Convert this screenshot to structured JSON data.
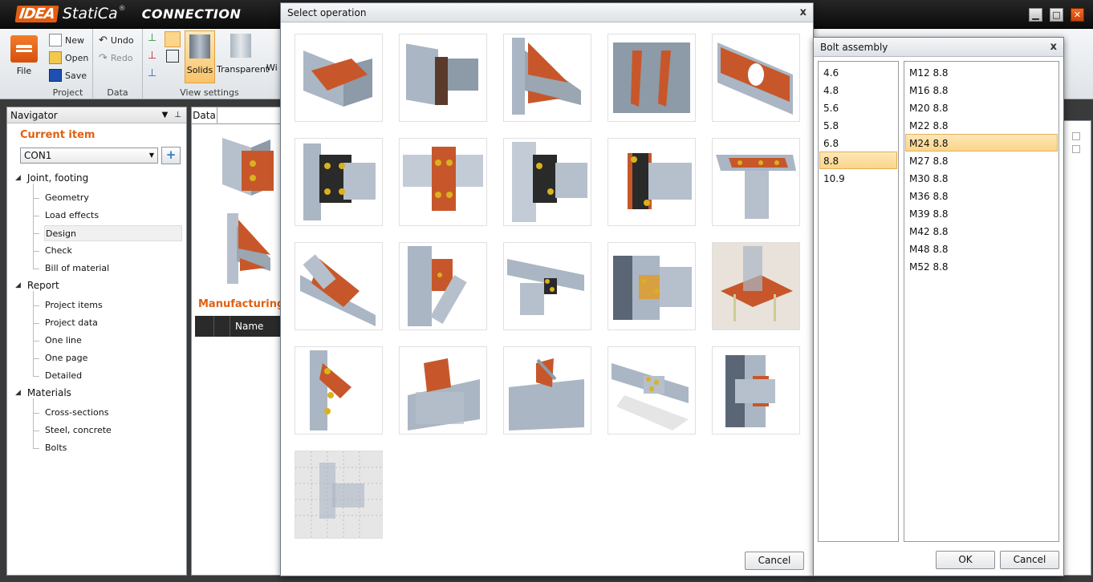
{
  "app": {
    "brand": "IDEA",
    "product": "StatiCa",
    "registered": "®",
    "module": "CONNECTION"
  },
  "window_controls": {
    "minimize": "▁",
    "maximize": "□",
    "close": "✕"
  },
  "ribbon": {
    "file_label": "File",
    "project": {
      "new": "New",
      "open": "Open",
      "save": "Save",
      "label": "Project"
    },
    "data": {
      "undo": "Undo",
      "redo": "Redo",
      "label": "Data"
    },
    "view": {
      "solids": "Solids",
      "transparent": "Transparent",
      "wire": "Wi",
      "label": "View settings"
    }
  },
  "navigator": {
    "title": "Navigator",
    "pin": "📌",
    "close": "✕",
    "current_item_title": "Current item",
    "current_item_value": "CON1",
    "add_button": "+",
    "sections": [
      {
        "label": "Joint, footing",
        "items": [
          "Geometry",
          "Load effects",
          "Design",
          "Check",
          "Bill of material"
        ]
      },
      {
        "label": "Report",
        "items": [
          "Project items",
          "Project data",
          "One line",
          "One page",
          "Detailed"
        ]
      },
      {
        "label": "Materials",
        "items": [
          "Cross-sections",
          "Steel, concrete",
          "Bolts"
        ]
      }
    ],
    "selected": "Design"
  },
  "data_panel": {
    "tab": "Data",
    "manufacturing_title": "Manufacturing o",
    "name_header": "Name"
  },
  "select_operation": {
    "title": "Select operation",
    "close": "x",
    "cancel": "Cancel",
    "tiles": [
      "end-plate-beam",
      "end-plate-splice",
      "stiffener-cut",
      "rib-stiffeners",
      "opening-plate",
      "bolted-end-plate",
      "bolted-joint",
      "bolted-column-joint",
      "end-plate-bolts",
      "cap-plate-bolts",
      "brace-gusset",
      "diagonal-gusset",
      "beam-cleat",
      "column-beam-fin",
      "base-plate-anchors",
      "bolted-haunch",
      "fin-plate",
      "gusset-plate",
      "bolted-splice",
      "welded-stiffener",
      "grid-model"
    ]
  },
  "bolt_assembly": {
    "title": "Bolt assembly",
    "close": "x",
    "grades": [
      "4.6",
      "4.8",
      "5.6",
      "5.8",
      "6.8",
      "8.8",
      "10.9"
    ],
    "selected_grade": "8.8",
    "bolts": [
      "M12 8.8",
      "M16 8.8",
      "M20 8.8",
      "M22 8.8",
      "M24 8.8",
      "M27 8.8",
      "M30 8.8",
      "M36 8.8",
      "M39 8.8",
      "M42 8.8",
      "M48 8.8",
      "M52 8.8"
    ],
    "selected_bolt": "M24 8.8",
    "ok": "OK",
    "cancel": "Cancel"
  },
  "colors": {
    "accent": "#e06010",
    "steel": "#aab6c4",
    "plate": "#c7572a",
    "bolt": "#d9b21c",
    "selected": "#fbd58a"
  }
}
